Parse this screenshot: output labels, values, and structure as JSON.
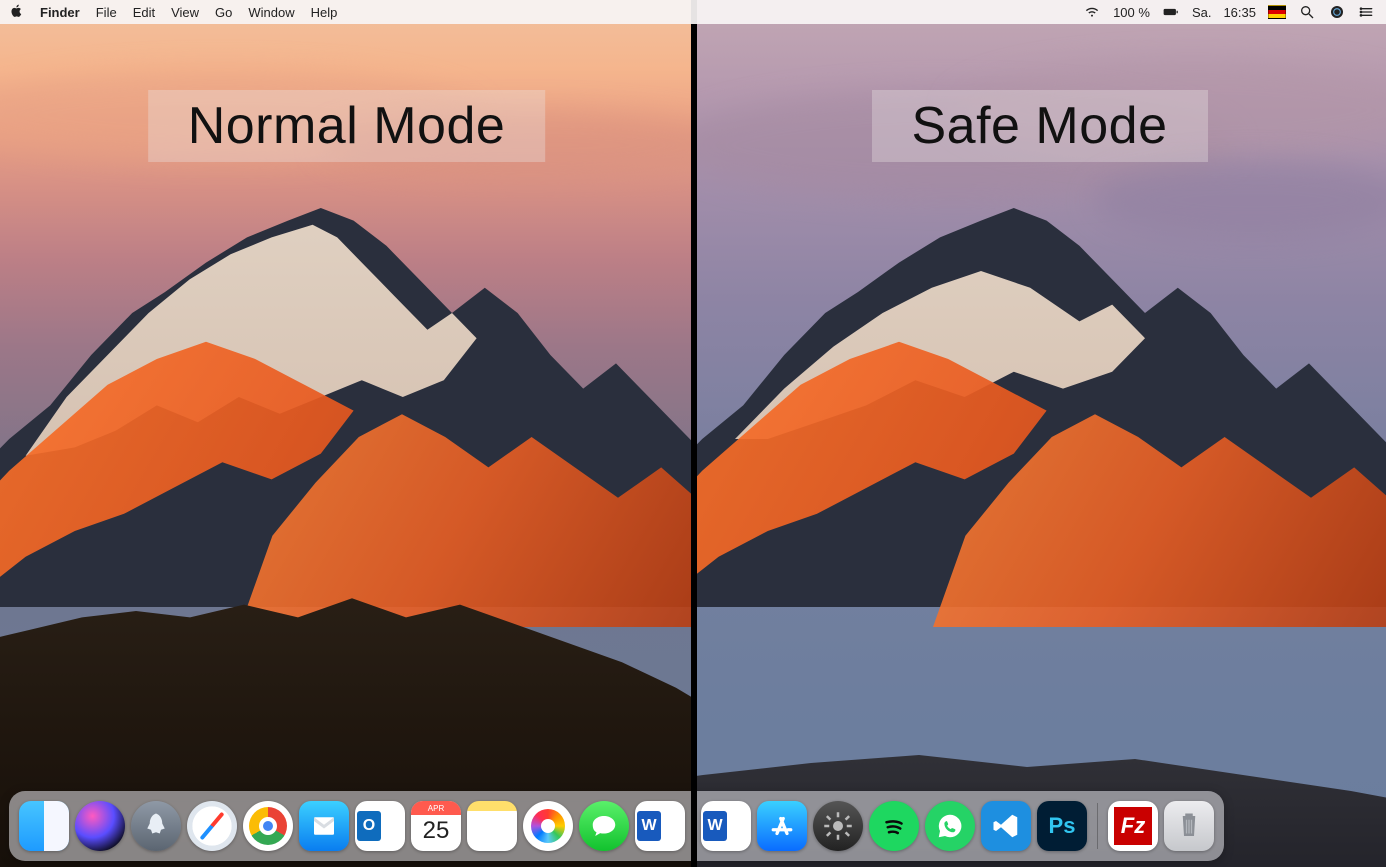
{
  "menubar": {
    "app": "Finder",
    "items": [
      "File",
      "Edit",
      "View",
      "Go",
      "Window",
      "Help"
    ],
    "status": {
      "battery_pct": "100 %",
      "day": "Sa.",
      "time": "16:35"
    }
  },
  "labels": {
    "left": "Normal Mode",
    "right": "Safe Mode"
  },
  "calendar": {
    "month_abbrev": "APR",
    "day": "25"
  },
  "dock_left": [
    {
      "id": "finder",
      "name": "Finder"
    },
    {
      "id": "siri",
      "name": "Siri"
    },
    {
      "id": "launchpad",
      "name": "Launchpad"
    },
    {
      "id": "safari",
      "name": "Safari"
    },
    {
      "id": "chrome",
      "name": "Google Chrome"
    },
    {
      "id": "mail",
      "name": "Mail"
    },
    {
      "id": "outlook",
      "name": "Microsoft Outlook"
    },
    {
      "id": "calendar",
      "name": "Calendar"
    },
    {
      "id": "notes",
      "name": "Notes"
    },
    {
      "id": "photos",
      "name": "Photos"
    },
    {
      "id": "messages",
      "name": "Messages"
    },
    {
      "id": "word",
      "name": "Microsoft Word"
    }
  ],
  "dock_right": [
    {
      "id": "word",
      "name": "Microsoft Word"
    },
    {
      "id": "appstore",
      "name": "App Store"
    },
    {
      "id": "settings",
      "name": "System Preferences"
    },
    {
      "id": "spotify",
      "name": "Spotify"
    },
    {
      "id": "whatsapp",
      "name": "WhatsApp"
    },
    {
      "id": "vscode",
      "name": "Visual Studio Code"
    },
    {
      "id": "ps",
      "name": "Adobe Photoshop"
    },
    {
      "id": "filezilla",
      "name": "FileZilla"
    },
    {
      "id": "trash",
      "name": "Trash"
    }
  ],
  "ps_label": "Ps",
  "fz_label": "Fz",
  "word_letter": "W",
  "outlook_letter": "O"
}
